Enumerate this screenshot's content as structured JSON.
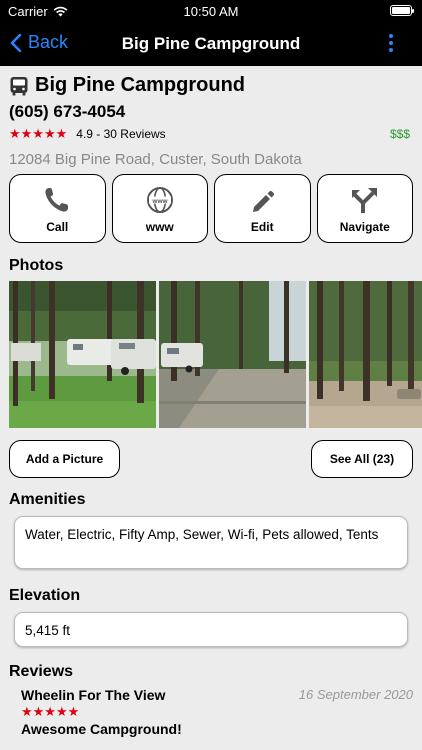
{
  "status_bar": {
    "carrier": "Carrier",
    "time": "10:50 AM"
  },
  "nav": {
    "back_label": "Back",
    "title": "Big Pine Campground"
  },
  "place": {
    "name": "Big Pine Campground",
    "phone": "(605) 673-4054",
    "stars": "★★★★★",
    "rating_text": "4.9 - 30 Reviews",
    "price": "$$$",
    "address": "12084 Big Pine Road, Custer, South Dakota"
  },
  "actions": [
    {
      "label": "Call",
      "icon": "phone-icon"
    },
    {
      "label": "www",
      "icon": "globe-icon"
    },
    {
      "label": "Edit",
      "icon": "pencil-icon"
    },
    {
      "label": "Navigate",
      "icon": "navigate-icon"
    }
  ],
  "photos": {
    "title": "Photos",
    "add_label": "Add a Picture",
    "see_all_label": "See All (23)",
    "items": [
      "rv-in-pines-photo",
      "campground-road-photo",
      "forest-campsite-photo"
    ]
  },
  "amenities": {
    "title": "Amenities",
    "text": "Water, Electric, Fifty Amp, Sewer, Wi-fi, Pets allowed, Tents"
  },
  "elevation": {
    "title": "Elevation",
    "value": "5,415 ft"
  },
  "reviews": {
    "title": "Reviews",
    "items": [
      {
        "author": "Wheelin For The View",
        "date": "16 September 2020",
        "stars": "★★★★★",
        "title": "Awesome Campground!"
      }
    ]
  },
  "colors": {
    "accent": "#2a84ff",
    "star_red": "#e00012",
    "price_green": "#2a9a34",
    "nav_bg": "#000000",
    "page_bg": "#ececec"
  }
}
